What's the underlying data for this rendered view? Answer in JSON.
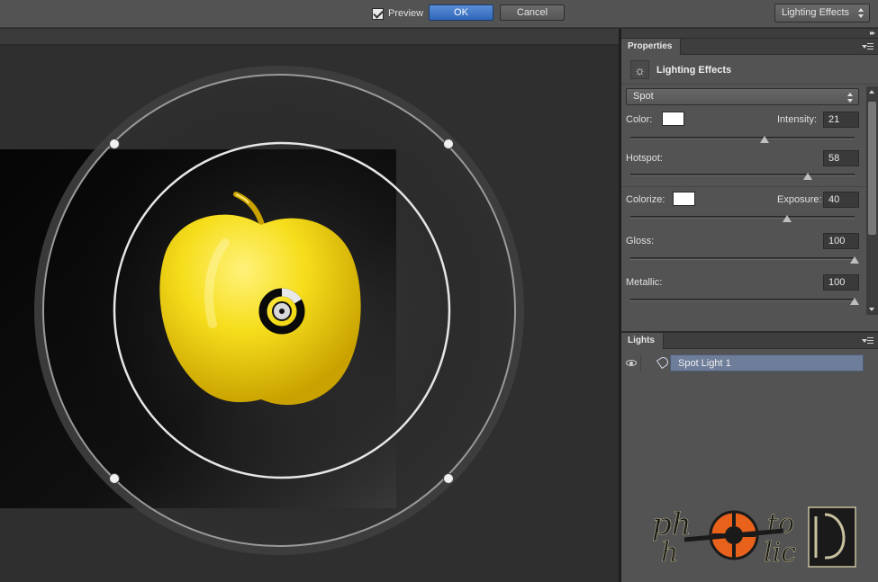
{
  "topbar": {
    "preview_label": "Preview",
    "preview_checked": true,
    "ok_label": "OK",
    "cancel_label": "Cancel",
    "preset_value": "Lighting Effects"
  },
  "properties": {
    "tab_label": "Properties",
    "icon": "light-bulb-icon",
    "title": "Lighting Effects",
    "light_type": "Spot",
    "color_label": "Color:",
    "color_value": "#ffffff",
    "intensity_label": "Intensity:",
    "intensity": "21",
    "hotspot_label": "Hotspot:",
    "hotspot": "58",
    "colorize_label": "Colorize:",
    "colorize_value": "#ffffff",
    "exposure_label": "Exposure:",
    "exposure": "40",
    "gloss_label": "Gloss:",
    "gloss": "100",
    "metallic_label": "Metallic:",
    "metallic": "100",
    "slider_levels": {
      "intensity": 0.6,
      "hotspot": 0.79,
      "exposure": 0.7,
      "gloss": 1.0,
      "metallic": 1.0
    }
  },
  "lights": {
    "tab_label": "Lights",
    "items": [
      {
        "name": "Spot Light 1",
        "visible": true,
        "icon": "spotlight-icon"
      }
    ]
  },
  "canvas": {
    "subject": "apple-image",
    "subject_color": "#f2d514"
  },
  "watermark": {
    "text": "photoholic"
  },
  "colors": {
    "ok_button": "#3d74c7",
    "selection": "#6e7d99",
    "panel_bg": "#535353",
    "canvas_bg": "#2f2f2f"
  }
}
